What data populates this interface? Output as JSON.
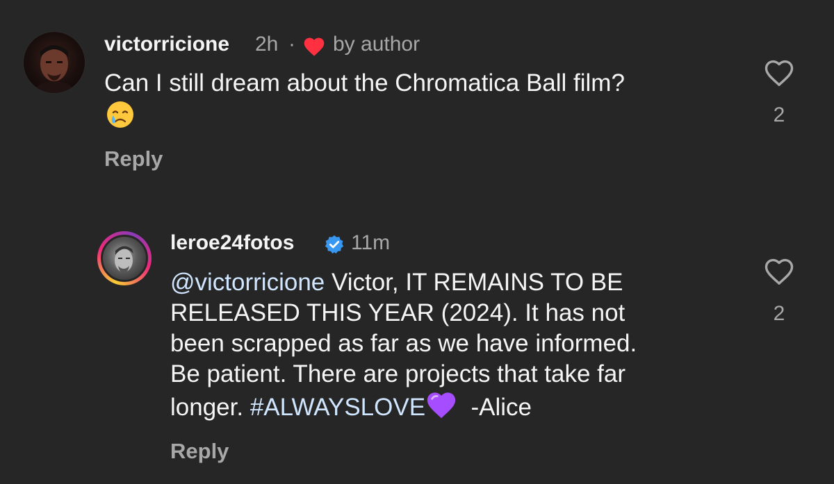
{
  "comments": [
    {
      "username": "victorricione",
      "time": "2h",
      "separator": "·",
      "author_badge_label": "by author",
      "text": "Can I still dream about the Chromatica Ball film?",
      "emoji": "crying-face",
      "reply_label": "Reply",
      "like_count": "2",
      "liked_by_author": true
    },
    {
      "username": "leroe24fotos",
      "verified": true,
      "time": "11m",
      "mention": "@victorricione",
      "text_line1_rest": " Victor, IT REMAINS TO BE",
      "text_line2": "RELEASED THIS YEAR (2024). It has not",
      "text_line3": "been scrapped as far as we have informed.",
      "text_line4": "Be patient. There are projects that take far",
      "text_line5_pre": "longer. ",
      "hashtag": "#ALWAYSLOVE",
      "emoji": "purple-heart",
      "signature": "  -Alice",
      "reply_label": "Reply",
      "like_count": "2"
    }
  ],
  "colors": {
    "background": "#262626",
    "primary_text": "#f5f5f5",
    "secondary_text": "#a8a8a8",
    "author_heart": "#ff3040",
    "verified_badge": "#3897f0",
    "purple_heart": "#a64dff"
  },
  "icons": [
    "heart-outline-icon",
    "red-heart-icon",
    "verified-badge-icon",
    "crying-face-emoji",
    "purple-heart-emoji"
  ]
}
